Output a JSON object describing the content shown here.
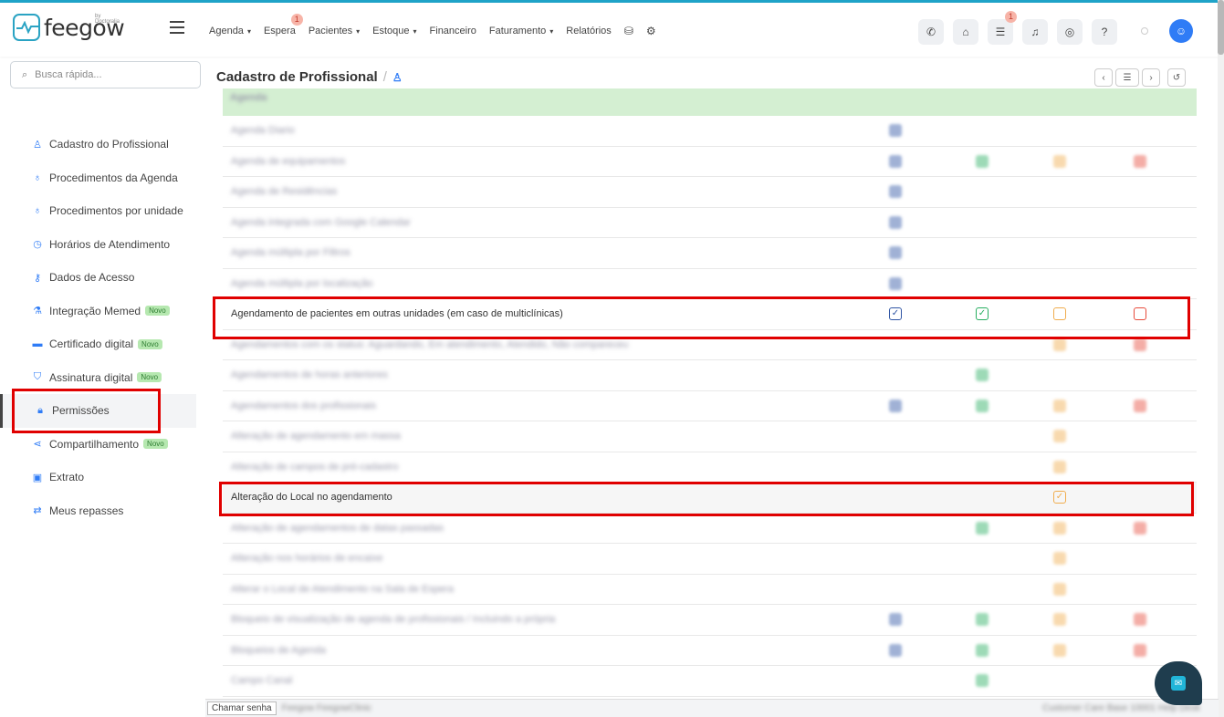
{
  "brand": {
    "name": "feegow",
    "by": "by Doctoralia"
  },
  "nav": {
    "items": [
      {
        "label": "Agenda",
        "caret": true
      },
      {
        "label": "Espera",
        "badge": "1"
      },
      {
        "label": "Pacientes",
        "caret": true
      },
      {
        "label": "Estoque",
        "caret": true
      },
      {
        "label": "Financeiro"
      },
      {
        "label": "Faturamento",
        "caret": true
      },
      {
        "label": "Relatórios"
      }
    ],
    "tool_badge": "1"
  },
  "search": {
    "placeholder": "Busca rápida..."
  },
  "sidebar": {
    "items": [
      {
        "label": "Cadastro do Profissional",
        "icon": "user-icon"
      },
      {
        "label": "Procedimentos da Agenda",
        "icon": "stethoscope-icon"
      },
      {
        "label": "Procedimentos por unidade",
        "icon": "stethoscope-icon"
      },
      {
        "label": "Horários de Atendimento",
        "icon": "clock-icon"
      },
      {
        "label": "Dados de Acesso",
        "icon": "key-icon"
      },
      {
        "label": "Integração Memed",
        "icon": "flask-icon",
        "badge": "Novo"
      },
      {
        "label": "Certificado digital",
        "icon": "card-icon",
        "badge": "Novo"
      },
      {
        "label": "Assinatura digital",
        "icon": "shield-icon",
        "badge": "Novo"
      },
      {
        "label": "Permissões",
        "icon": "lock-icon",
        "active": true
      },
      {
        "label": "Compartilhamento",
        "icon": "share-icon",
        "badge": "Novo"
      },
      {
        "label": "Extrato",
        "icon": "money-icon"
      },
      {
        "label": "Meus repasses",
        "icon": "transfer-icon"
      }
    ]
  },
  "page": {
    "title": "Cadastro de Profissional"
  },
  "permissions": {
    "section": "Agenda",
    "rows": [
      {
        "label": "Agenda Diario",
        "blur": true,
        "cols": [
          "b"
        ]
      },
      {
        "label": "Agenda de equipamentos",
        "blur": true,
        "cols": [
          "b",
          "g",
          "y",
          "r"
        ]
      },
      {
        "label": "Agenda de Residências",
        "blur": true,
        "cols": [
          "b"
        ]
      },
      {
        "label": "Agenda integrada com Google Calendar",
        "blur": true,
        "cols": [
          "b"
        ]
      },
      {
        "label": "Agenda múltipla por Filtros",
        "blur": true,
        "cols": [
          "b"
        ]
      },
      {
        "label": "Agenda múltipla por localização",
        "blur": true,
        "cols": [
          "b"
        ]
      },
      {
        "label": "Agendamento de pacientes em outras unidades (em caso de multiclínicas)",
        "blur": false,
        "cols": [
          "b",
          "g",
          "y",
          "r"
        ],
        "checked": [
          "b",
          "g"
        ]
      },
      {
        "label": "Agendamentos com os status: Aguardando, Em atendimento, Atendido, Não compareceu",
        "blur": true,
        "cols": [
          "y",
          "r"
        ]
      },
      {
        "label": "Agendamentos de horas anteriores",
        "blur": true,
        "cols": [
          "g"
        ]
      },
      {
        "label": "Agendamentos dos profissionais",
        "blur": true,
        "cols": [
          "b",
          "g",
          "y",
          "r"
        ]
      },
      {
        "label": "Alteração de agendamento em massa",
        "blur": true,
        "cols": [
          "y"
        ]
      },
      {
        "label": "Alteração de campos de pré-cadastro",
        "blur": true,
        "cols": [
          "y"
        ]
      },
      {
        "label": "Alteração do Local no agendamento",
        "blur": false,
        "cols": [
          "y"
        ],
        "checked": [
          "y"
        ]
      },
      {
        "label": "Alteração de agendamentos de datas passadas",
        "blur": true,
        "cols": [
          "g",
          "y",
          "r"
        ]
      },
      {
        "label": "Alteração nos horários de encaixe",
        "blur": true,
        "cols": [
          "y"
        ]
      },
      {
        "label": "Alterar o Local de Atendimento na Sala de Espera",
        "blur": true,
        "cols": [
          "y"
        ]
      },
      {
        "label": "Bloqueio de visualização de agenda de profissionais / Incluindo a própria",
        "blur": true,
        "cols": [
          "b",
          "g",
          "y",
          "r"
        ]
      },
      {
        "label": "Bloqueios de Agenda",
        "blur": true,
        "cols": [
          "b",
          "g",
          "y",
          "r"
        ]
      },
      {
        "label": "Campo Canal",
        "blur": true,
        "cols": [
          "g"
        ]
      }
    ]
  },
  "footer": {
    "call_label": "Chamar senha",
    "blur_text": "Feegow FeegowClinic",
    "right_text": "Customer Care Base 10001 Help Desk"
  },
  "colors": {
    "accent": "#2f7cf6",
    "highlight": "#e00000",
    "section_bg": "#d4efd2"
  }
}
